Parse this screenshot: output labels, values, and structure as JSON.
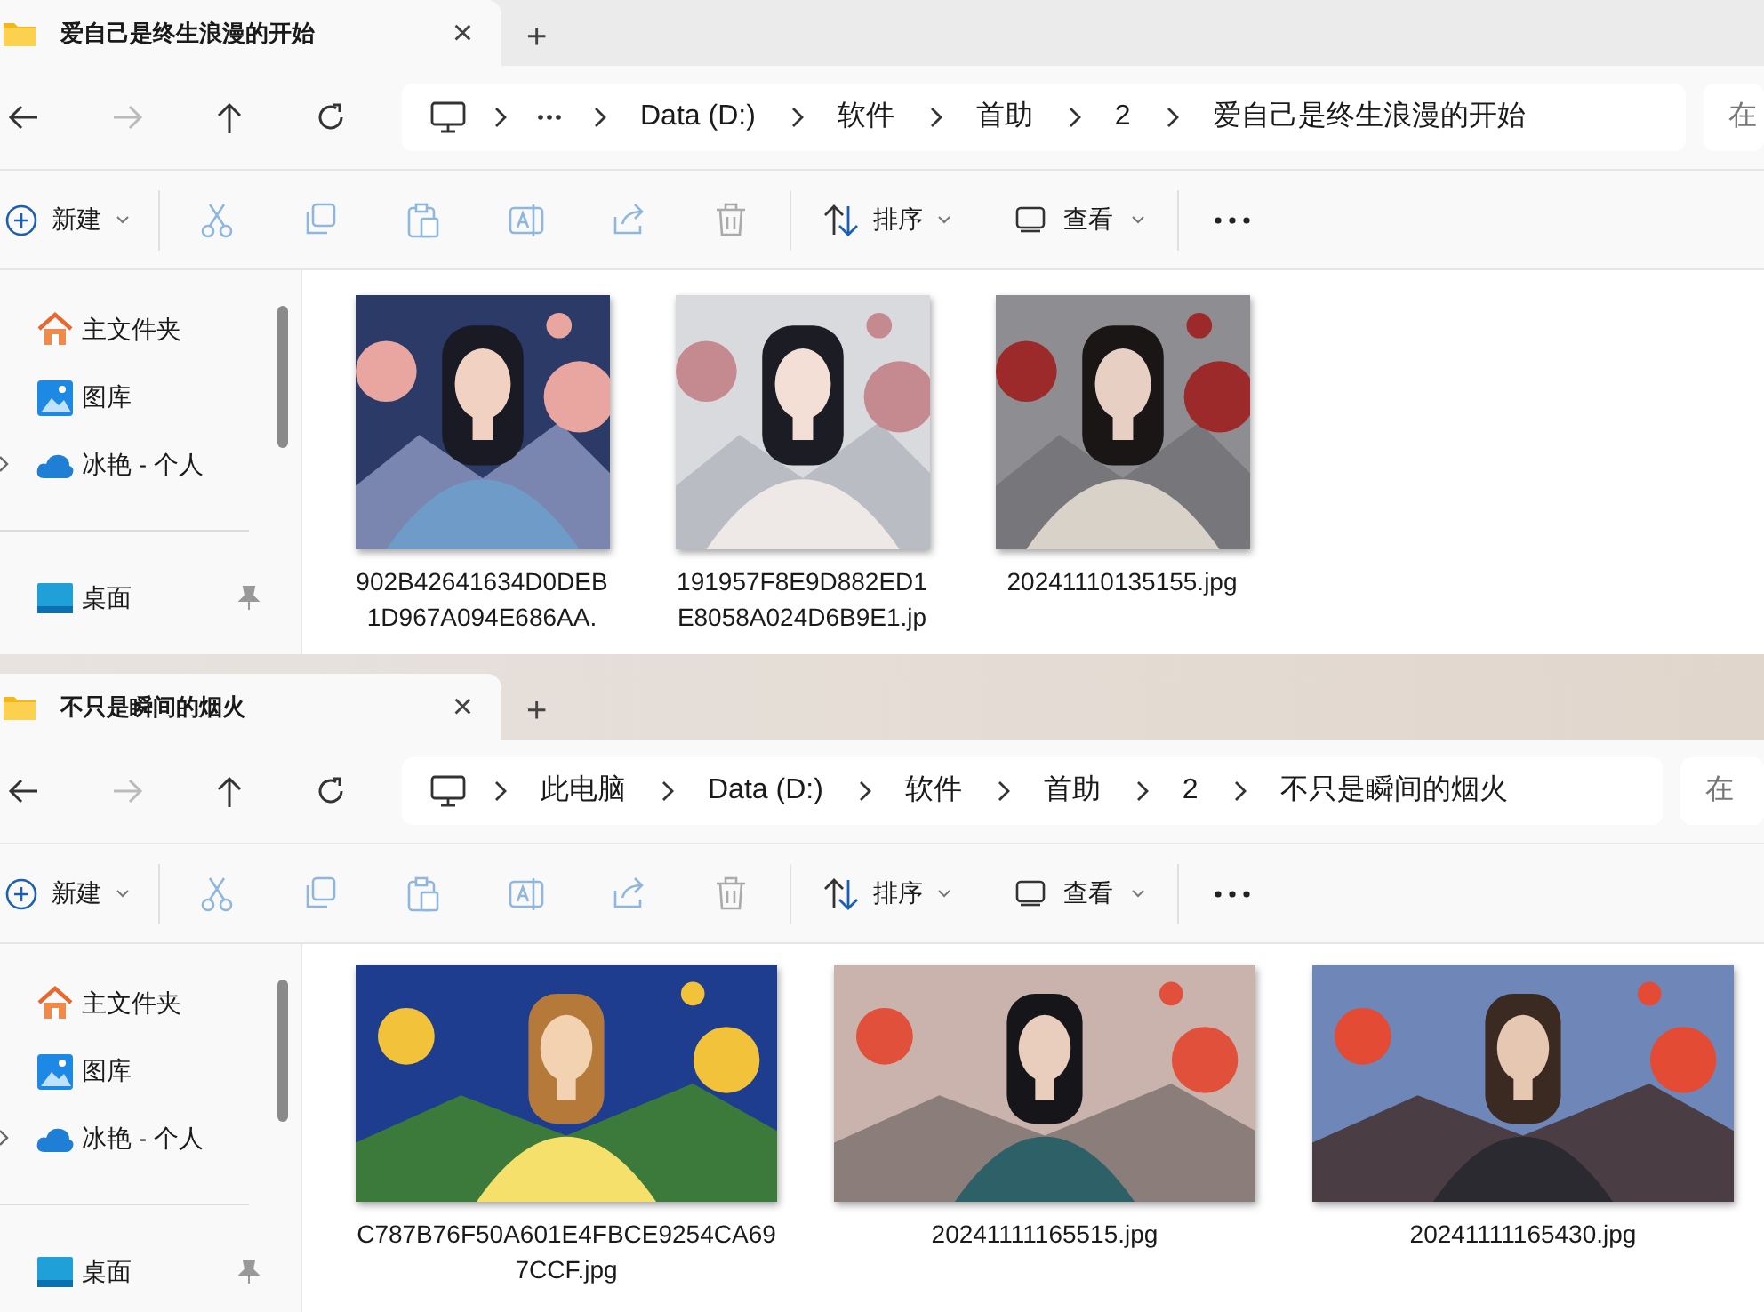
{
  "windows": [
    {
      "tab": {
        "title": "爱自己是终生浪漫的开始",
        "close": "×",
        "new_tab": "+"
      },
      "nav": {
        "forward_disabled": true
      },
      "breadcrumb": [
        {
          "kind": "overflow"
        },
        {
          "kind": "text",
          "label": "Data (D:)"
        },
        {
          "kind": "text",
          "label": "软件"
        },
        {
          "kind": "text",
          "label": "首助"
        },
        {
          "kind": "text",
          "label": "2"
        },
        {
          "kind": "text",
          "label": "爱自己是终生浪漫的开始"
        }
      ],
      "search": {
        "placeholder": "在"
      },
      "toolbar": {
        "new": "新建",
        "sort": "排序",
        "view": "查看"
      },
      "sidebar": [
        {
          "kind": "home",
          "label": "主文件夹"
        },
        {
          "kind": "gallery",
          "label": "图库"
        },
        {
          "kind": "cloud",
          "label": "冰艳 - 个人"
        },
        {
          "kind": "separator"
        },
        {
          "kind": "desktop",
          "label": "桌面"
        }
      ],
      "kind": "square",
      "files": [
        {
          "name": "902B42641634D0DEB1D967A094E686AA."
        },
        {
          "name": "191957F8E9D882ED1E8058A024D6B9E1.jp"
        },
        {
          "name": "20241110135155.jpg"
        }
      ]
    },
    {
      "tab": {
        "title": "不只是瞬间的烟火",
        "close": "×",
        "new_tab": "+"
      },
      "nav": {
        "forward_disabled": true
      },
      "breadcrumb": [
        {
          "kind": "text",
          "label": "此电脑"
        },
        {
          "kind": "text",
          "label": "Data (D:)"
        },
        {
          "kind": "text",
          "label": "软件"
        },
        {
          "kind": "text",
          "label": "首助"
        },
        {
          "kind": "text",
          "label": "2"
        },
        {
          "kind": "text",
          "label": "不只是瞬间的烟火"
        }
      ],
      "search": {
        "placeholder": "在"
      },
      "toolbar": {
        "new": "新建",
        "sort": "排序",
        "view": "查看"
      },
      "sidebar": [
        {
          "kind": "home",
          "label": "主文件夹"
        },
        {
          "kind": "gallery",
          "label": "图库"
        },
        {
          "kind": "cloud",
          "label": "冰艳 - 个人"
        },
        {
          "kind": "separator"
        },
        {
          "kind": "desktop",
          "label": "桌面"
        }
      ],
      "kind": "wide",
      "files": [
        {
          "name": "C787B76F50A601E4FBCE9254CA697CCF.jpg"
        },
        {
          "name": "20241111165515.jpg"
        },
        {
          "name": "20241111165430.jpg"
        }
      ]
    }
  ]
}
